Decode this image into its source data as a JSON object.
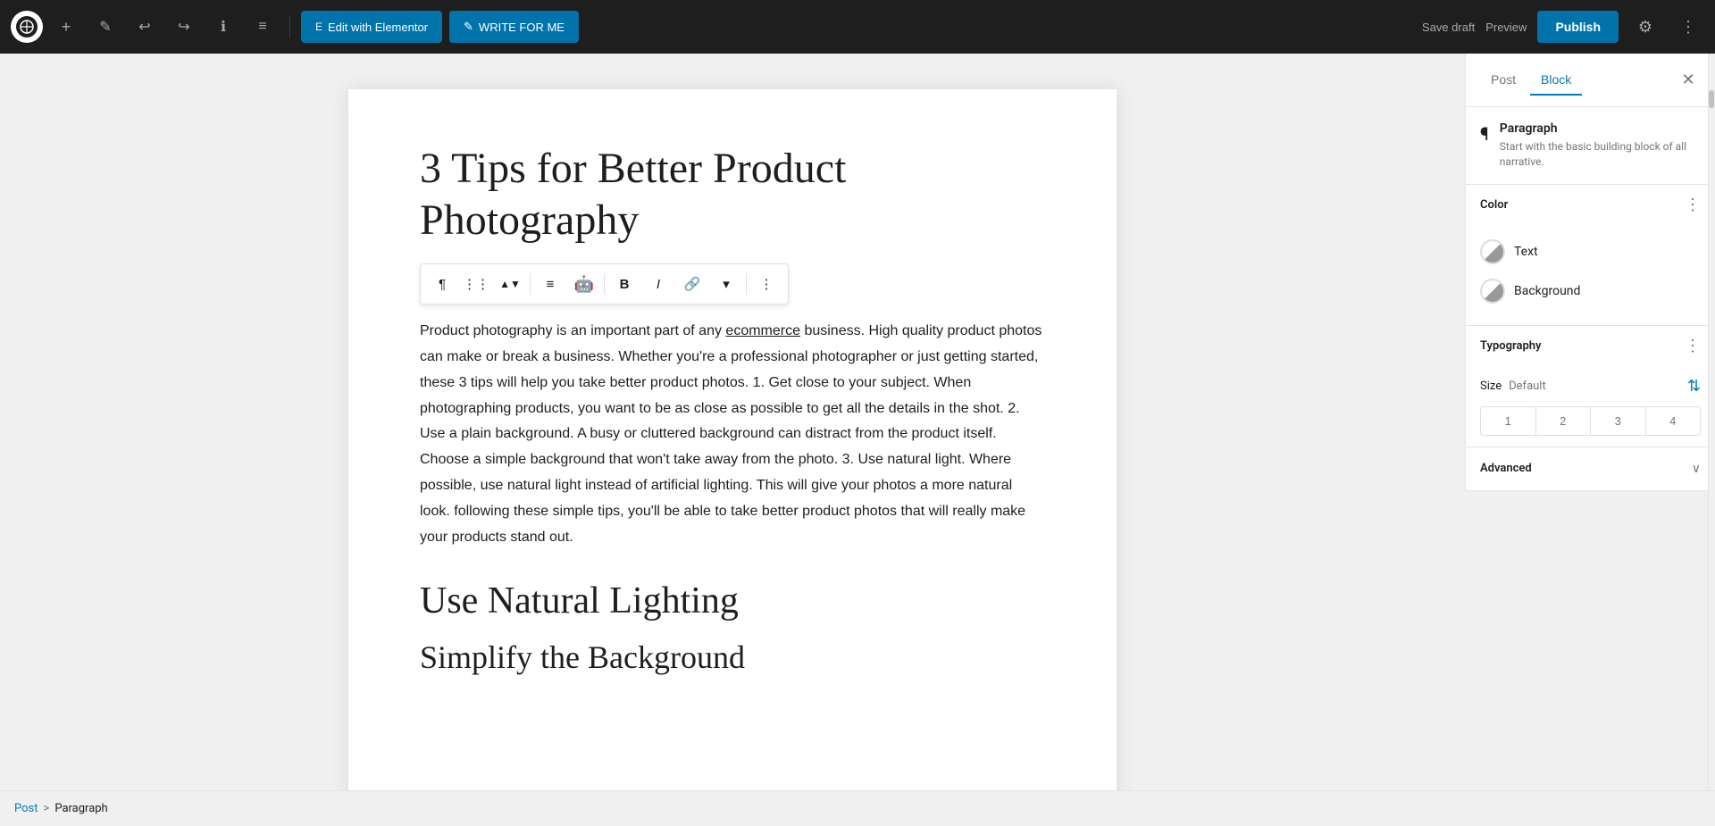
{
  "topbar": {
    "wp_logo": "W",
    "add_label": "+",
    "edit_label": "✎",
    "undo_label": "↩",
    "redo_label": "↪",
    "info_label": "ℹ",
    "list_label": "≡",
    "elementor_btn": "Edit with Elementor",
    "write_btn": "✎ WRITE FOR ME",
    "save_draft_label": "Save draft",
    "preview_label": "Preview",
    "publish_label": "Publish",
    "settings_label": "⚙",
    "more_label": "⋮"
  },
  "editor": {
    "title": "3 Tips for Better Product Photography",
    "body": "Product photography is an important part of any ecommerce business. High quality product photos can make or break a business. Whether you're a professional photographer or just getting started, these 3 tips will help you take better product photos. 1. Get close to your subject. When photographing products, you want to be as close as possible to get all the details in the shot. 2. Use a plain background. A busy or cluttered background can distract from the product itself. Choose a simple background that won't take away from the photo. 3. Use natural light. Where possible, use natural light instead of artificial lighting. This will give your photos a more natural look.  following these simple tips, you'll be able to take better product photos that will really make your products stand out.",
    "section_heading": "Use Natural Lighting",
    "section_subheading": "Simplify the Background"
  },
  "toolbar": {
    "paragraph_icon": "¶",
    "drag_icon": "⋮⋮",
    "move_icon": "⬍",
    "align_icon": "≡",
    "inserter_icon": "🤖",
    "bold_icon": "B",
    "italic_icon": "I",
    "link_icon": "🔗",
    "more_icon": "⋮"
  },
  "sidebar": {
    "post_tab": "Post",
    "block_tab": "Block",
    "close_btn": "✕",
    "block_icon": "¶",
    "block_name": "Paragraph",
    "block_description": "Start with the basic building block of all narrative.",
    "color_section": {
      "title": "Color",
      "more_icon": "⋮",
      "text_label": "Text",
      "background_label": "Background"
    },
    "typography_section": {
      "title": "Typography",
      "more_icon": "⋮",
      "size_label": "Size",
      "size_value": "Default",
      "adjust_icon": "⇅",
      "font_sizes": [
        "1",
        "2",
        "3",
        "4"
      ]
    },
    "advanced_section": {
      "title": "Advanced",
      "chevron": "∨"
    }
  },
  "breadcrumb": {
    "post_label": "Post",
    "separator": ">",
    "current_label": "Paragraph"
  }
}
